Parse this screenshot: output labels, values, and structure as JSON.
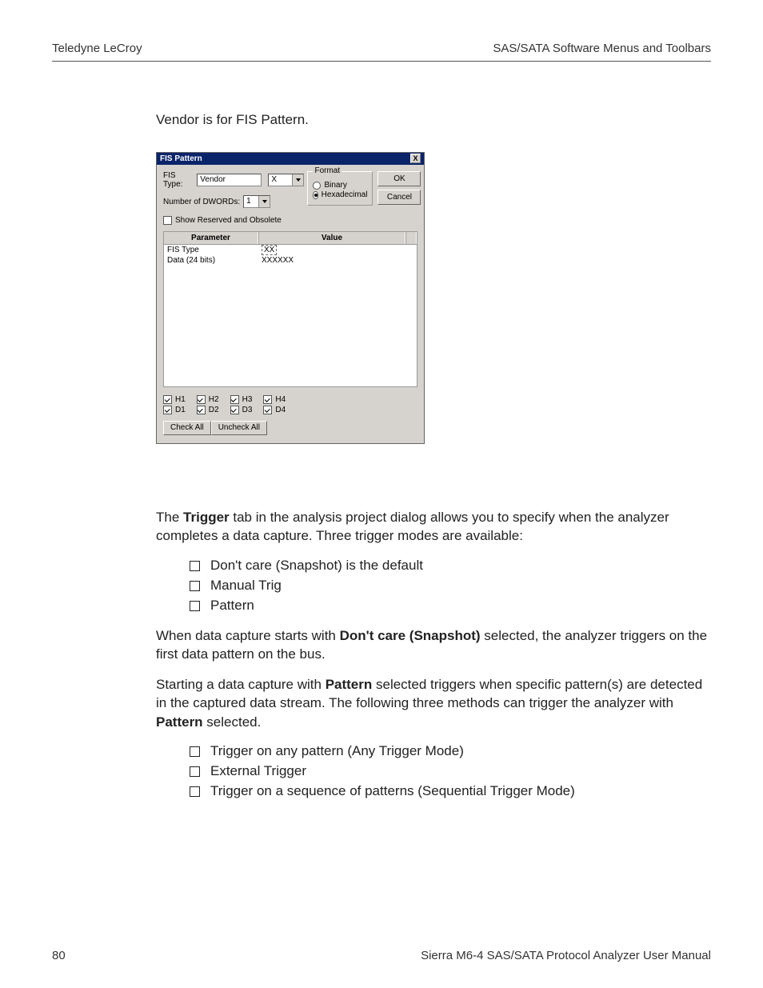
{
  "header": {
    "left": "Teledyne LeCroy",
    "right": "SAS/SATA Software Menus and Toolbars"
  },
  "intro": "Vendor is for FIS Pattern.",
  "dialog": {
    "title": "FIS Pattern",
    "close": "X",
    "fis_type_label": "FIS Type:",
    "fis_type_value": "Vendor",
    "fis_type_x": "X",
    "num_dwords_label": "Number of DWORDs:",
    "num_dwords_value": "1",
    "show_reserved": "Show Reserved and Obsolete",
    "format": {
      "legend": "Format",
      "binary": "Binary",
      "hex": "Hexadecimal",
      "selected": "hex"
    },
    "ok": "OK",
    "cancel": "Cancel",
    "columns": {
      "param": "Parameter",
      "value": "Value"
    },
    "rows": [
      {
        "param": "FIS Type",
        "value": "XX"
      },
      {
        "param": "Data (24 bits)",
        "value": "XXXXXX"
      }
    ],
    "hd_row1": [
      "H1",
      "H2",
      "H3",
      "H4"
    ],
    "hd_row2": [
      "D1",
      "D2",
      "D3",
      "D4"
    ],
    "check_all": "Check All",
    "uncheck_all": "Uncheck All"
  },
  "para1_pre": " The ",
  "para1_bold": "Trigger",
  "para1_post": " tab in the analysis project dialog allows you to specify when the analyzer completes a data capture. Three trigger modes are available:",
  "list1": [
    "Don't care (Snapshot) is the default",
    "Manual Trig",
    "Pattern"
  ],
  "para2_pre": "When data capture starts with ",
  "para2_bold": "Don't care (Snapshot)",
  "para2_post": " selected, the analyzer triggers on the first data pattern on the bus.",
  "para3_pre": "Starting a data capture with ",
  "para3_bold1": "Pattern",
  "para3_mid": " selected triggers when specific pattern(s) are detected in the captured data stream. The following three methods can trigger the analyzer with ",
  "para3_bold2": "Pattern",
  "para3_post": " selected.",
  "list2": [
    "Trigger on any pattern (Any Trigger Mode)",
    "External Trigger",
    "Trigger on a sequence of patterns (Sequential Trigger Mode)"
  ],
  "footer": {
    "page": "80",
    "manual": "Sierra M6-4 SAS/SATA Protocol Analyzer User Manual"
  }
}
